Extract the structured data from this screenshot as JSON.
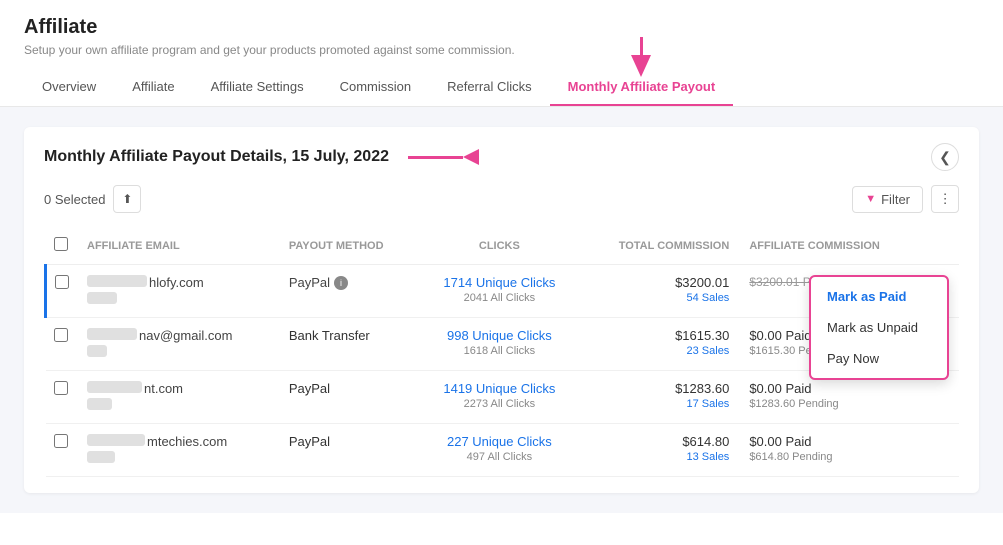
{
  "page": {
    "title": "Affiliate",
    "subtitle": "Setup your own affiliate program and get your products promoted against some commission."
  },
  "nav": {
    "tabs": [
      {
        "id": "overview",
        "label": "Overview",
        "active": false
      },
      {
        "id": "affiliate",
        "label": "Affiliate",
        "active": false
      },
      {
        "id": "affiliate-settings",
        "label": "Affiliate Settings",
        "active": false
      },
      {
        "id": "commission",
        "label": "Commission",
        "active": false
      },
      {
        "id": "referral-clicks",
        "label": "Referral Clicks",
        "active": false
      },
      {
        "id": "monthly-affiliate-payout",
        "label": "Monthly Affiliate Payout",
        "active": true
      }
    ]
  },
  "card": {
    "title": "Monthly Affiliate Payout Details, 15 July, 2022",
    "selected_count": "0 Selected",
    "filter_label": "Filter",
    "columns": [
      {
        "id": "email",
        "label": "Affiliate Email"
      },
      {
        "id": "method",
        "label": "Payout Method"
      },
      {
        "id": "clicks",
        "label": "Clicks"
      },
      {
        "id": "total_commission",
        "label": "Total Commission"
      },
      {
        "id": "affiliate_commission",
        "label": "Affiliate Commission"
      }
    ],
    "rows": [
      {
        "id": 1,
        "email_prefix": "hlofy.com",
        "email_blur_width": 60,
        "email_sub_blur": 30,
        "method": "PayPal",
        "method_info": true,
        "unique_clicks": "1714 Unique Clicks",
        "all_clicks": "2041 All Clicks",
        "total_commission": "$3200.01",
        "sales": "54 Sales",
        "aff_commission_paid": "$3200.01 Paid",
        "aff_commission_paid_strikethrough": true,
        "aff_commission_pending": "",
        "has_dropdown": true,
        "highlighted": true
      },
      {
        "id": 2,
        "email_prefix": "nav@gmail.com",
        "email_blur_width": 50,
        "email_sub_blur": 20,
        "method": "Bank Transfer",
        "method_info": false,
        "unique_clicks": "998 Unique Clicks",
        "all_clicks": "1618 All Clicks",
        "total_commission": "$1615.30",
        "sales": "23 Sales",
        "aff_commission_paid": "$0.00 Paid",
        "aff_commission_paid_strikethrough": false,
        "aff_commission_pending": "$1615.30 Pending",
        "has_dropdown": false,
        "highlighted": false
      },
      {
        "id": 3,
        "email_prefix": "nt.com",
        "email_blur_width": 55,
        "email_sub_blur": 25,
        "method": "PayPal",
        "method_info": false,
        "unique_clicks": "1419 Unique Clicks",
        "all_clicks": "2273 All Clicks",
        "total_commission": "$1283.60",
        "sales": "17 Sales",
        "aff_commission_paid": "$0.00 Paid",
        "aff_commission_paid_strikethrough": false,
        "aff_commission_pending": "$1283.60 Pending",
        "has_dropdown": false,
        "highlighted": false
      },
      {
        "id": 4,
        "email_prefix": "mtechies.com",
        "email_blur_width": 58,
        "email_sub_blur": 28,
        "method": "PayPal",
        "method_info": false,
        "unique_clicks": "227 Unique Clicks",
        "all_clicks": "497 All Clicks",
        "total_commission": "$614.80",
        "sales": "13 Sales",
        "aff_commission_paid": "$0.00 Paid",
        "aff_commission_paid_strikethrough": false,
        "aff_commission_pending": "$614.80 Pending",
        "has_dropdown": false,
        "highlighted": false
      }
    ],
    "dropdown_items": [
      {
        "id": "mark-paid",
        "label": "Mark as Paid",
        "active": true
      },
      {
        "id": "mark-unpaid",
        "label": "Mark as Unpaid",
        "active": false
      },
      {
        "id": "pay-now",
        "label": "Pay Now",
        "active": false
      }
    ]
  },
  "icons": {
    "back": "❮",
    "export": "⬆",
    "filter": "▼",
    "more": "⋮",
    "info": "i",
    "arrow_down": "▼"
  }
}
